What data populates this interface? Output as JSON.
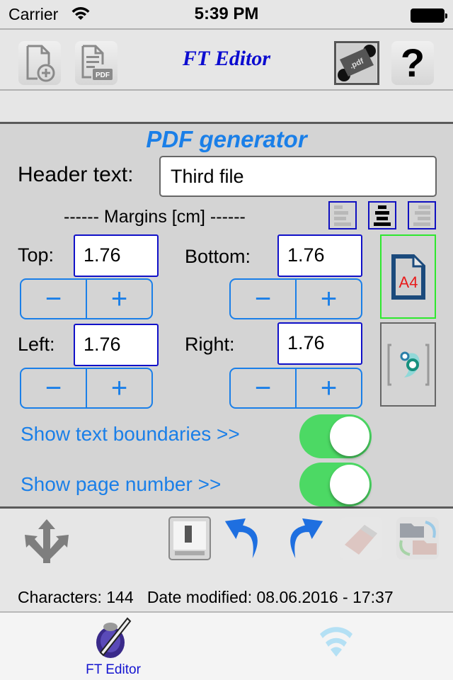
{
  "status_bar": {
    "carrier": "Carrier",
    "time": "5:39 PM",
    "icons": [
      "wifi-icon",
      "battery-icon"
    ]
  },
  "toolbar": {
    "title": "FT Editor",
    "buttons": [
      {
        "name": "new-document",
        "icon": "document-plus-icon"
      },
      {
        "name": "export-pdf",
        "icon": "pdf-document-icon"
      },
      {
        "name": "pdf-settings",
        "icon": "pdf-gear-icon"
      },
      {
        "name": "help",
        "icon": "question-mark-icon"
      }
    ]
  },
  "pdf_panel": {
    "title": "PDF generator",
    "header_label": "Header text:",
    "header_value": "Third file",
    "margins_label": "------ Margins [cm] ------",
    "alignment": {
      "options": [
        "left",
        "center",
        "right"
      ],
      "selected": "center"
    },
    "margins": {
      "top": {
        "label": "Top:",
        "value": "1.76"
      },
      "bottom": {
        "label": "Bottom:",
        "value": "1.76"
      },
      "left": {
        "label": "Left:",
        "value": "1.76"
      },
      "right": {
        "label": "Right:",
        "value": "1.76"
      }
    },
    "stepper": {
      "minus": "−",
      "plus": "+"
    },
    "side_buttons": {
      "paper_size": {
        "label": "A4",
        "icon": "a4-page-icon",
        "selected": true
      },
      "fit": {
        "icon": "fit-to-bounds-icon",
        "selected": false
      }
    },
    "toggles": [
      {
        "label": "Show text boundaries >>",
        "on": true
      },
      {
        "label": "Show page number >>",
        "on": true
      }
    ]
  },
  "actions": {
    "icons": [
      "share-arrows-icon",
      "document-scan-icon",
      "undo-icon",
      "redo-icon",
      "eraser-icon",
      "folder-sync-icon"
    ],
    "characters_label": "Characters:",
    "characters_value": "144",
    "date_label": "Date modified:",
    "date_value": "08.06.2016 - 17:37"
  },
  "tabbar": {
    "tabs": [
      {
        "label": "FT Editor",
        "icon": "ink-pen-icon",
        "selected": true
      },
      {
        "label": "",
        "icon": "wifi-icon",
        "selected": false
      }
    ]
  },
  "colors": {
    "accent_blue": "#1a7fe8",
    "title_blue": "#0c0cd0",
    "toggle_green": "#4cd964",
    "input_border": "#1010c8",
    "a4_border": "#2ee82e"
  }
}
